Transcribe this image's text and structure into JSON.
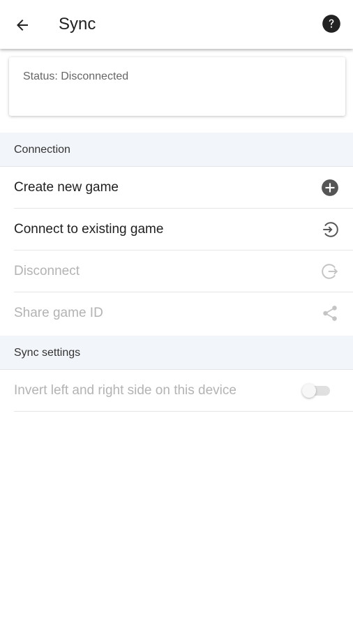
{
  "appbar": {
    "title": "Sync",
    "back_icon": "arrow-left-icon",
    "help_icon": "help-circle-icon"
  },
  "status": {
    "text": "Status: Disconnected"
  },
  "sections": {
    "connection": {
      "header": "Connection",
      "items": [
        {
          "label": "Create new game",
          "icon": "plus-circle-icon",
          "enabled": true
        },
        {
          "label": "Connect to existing game",
          "icon": "login-icon",
          "enabled": true
        },
        {
          "label": "Disconnect",
          "icon": "logout-icon",
          "enabled": false
        },
        {
          "label": "Share game ID",
          "icon": "share-icon",
          "enabled": false
        }
      ]
    },
    "sync_settings": {
      "header": "Sync settings",
      "items": [
        {
          "label": "Invert left and right side on this device",
          "control": "toggle",
          "checked": false,
          "enabled": false
        }
      ]
    }
  },
  "colors": {
    "text_primary": "#1f1f1f",
    "text_disabled": "#b3b3b3",
    "section_bg": "#f2f5f9",
    "icon_enabled": "#555555",
    "icon_disabled": "#c4c4c4"
  }
}
